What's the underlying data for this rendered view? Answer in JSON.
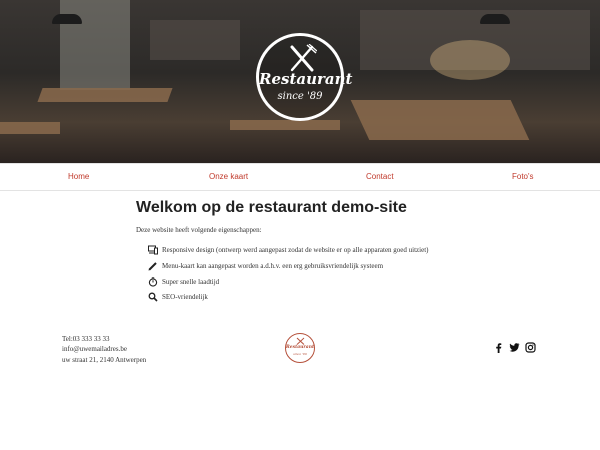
{
  "hero": {
    "logo_name": "Restaurant",
    "logo_since": "since '89",
    "background": "cafe-interior-photo"
  },
  "nav": {
    "items": [
      {
        "label": "Home"
      },
      {
        "label": "Onze kaart"
      },
      {
        "label": "Contact"
      },
      {
        "label": "Foto's"
      }
    ],
    "link_color": "#c0392b"
  },
  "main": {
    "title": "Welkom op de restaurant demo-site",
    "intro": "Deze website heeft volgende eigenschappen:",
    "features": [
      {
        "icon": "devices-icon",
        "text": "Responsive design (ontwerp werd aangepast zodat de website er op alle apparaten goed uitziet)"
      },
      {
        "icon": "pencil-icon",
        "text": "Menu-kaart kan aangepast worden a.d.h.v. een erg gebruiksvriendelijk systeem"
      },
      {
        "icon": "stopwatch-icon",
        "text": "Super snelle laadtijd"
      },
      {
        "icon": "search-icon",
        "text": "SEO-vriendelijk"
      }
    ]
  },
  "footer": {
    "phone": "Tel:03 333 33 33",
    "email": "info@uwemailadres.be",
    "address": "uw straat 21, 2140 Antwerpen",
    "logo_name": "Restaurant",
    "logo_since": "since '89",
    "logo_color": "#b5503a",
    "social": [
      "facebook-icon",
      "twitter-icon",
      "instagram-icon"
    ]
  }
}
